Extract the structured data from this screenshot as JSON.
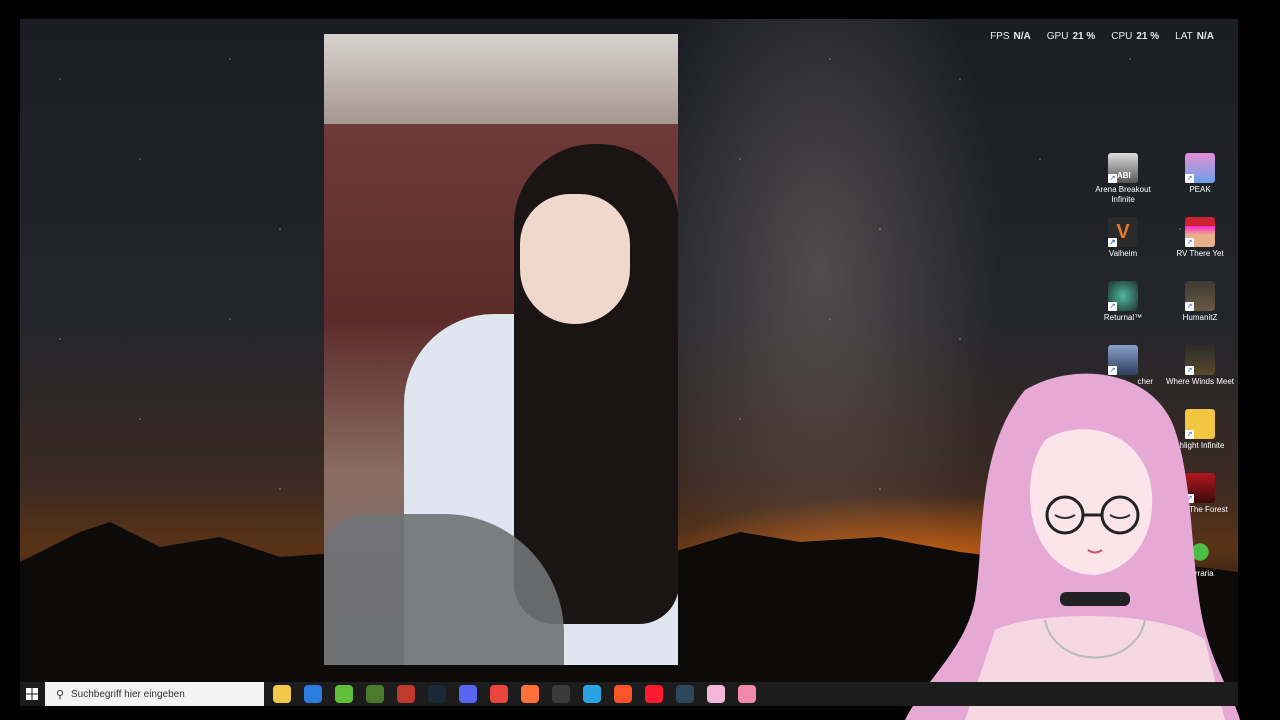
{
  "stats": [
    {
      "label": "FPS",
      "value": "N/A"
    },
    {
      "label": "GPU",
      "value": "21 %"
    },
    {
      "label": "CPU",
      "value": "21 %"
    },
    {
      "label": "LAT",
      "value": "N/A"
    }
  ],
  "desktop_icons": [
    {
      "label": "Arena Breakout Infinite",
      "icon": "arena-breakout-icon",
      "badge": "ABI"
    },
    {
      "label": "PEAK",
      "icon": "peak-icon"
    },
    {
      "label": "Valheim",
      "icon": "valheim-icon",
      "badge": "V"
    },
    {
      "label": "RV There Yet",
      "icon": "rv-there-yet-icon"
    },
    {
      "label": "Returnal™",
      "icon": "returnal-icon"
    },
    {
      "label": "HumanitZ",
      "icon": "humanitz-icon"
    },
    {
      "label": "cher",
      "icon": "launcher-icon"
    },
    {
      "label": "Where Winds Meet",
      "icon": "where-winds-meet-icon"
    },
    {
      "label": "chlight Infinite",
      "icon": "torchlight-infinite-icon"
    },
    {
      "label": "s Of The Forest",
      "icon": "sons-of-the-forest-icon"
    },
    {
      "label": "Terraria",
      "icon": "terraria-icon"
    }
  ],
  "taskbar": {
    "search_placeholder": "Suchbegriff hier eingeben",
    "apps": [
      {
        "name": "file-explorer-icon",
        "color": "#f2c94c"
      },
      {
        "name": "store-icon",
        "color": "#2d7de0"
      },
      {
        "name": "green-app-icon",
        "color": "#5fbf3b"
      },
      {
        "name": "minecraft-icon",
        "color": "#4a7b2c"
      },
      {
        "name": "red-app-icon",
        "color": "#c0392b"
      },
      {
        "name": "steam-icon",
        "color": "#1b2838"
      },
      {
        "name": "discord-icon",
        "color": "#5865f2"
      },
      {
        "name": "chrome-icon",
        "color": "#e8453c"
      },
      {
        "name": "firefox-icon",
        "color": "#ff7139"
      },
      {
        "name": "obs-icon",
        "color": "#3a3a3a"
      },
      {
        "name": "blue-app-icon",
        "color": "#2aa3e0"
      },
      {
        "name": "brave-icon",
        "color": "#fb542b"
      },
      {
        "name": "opera-icon",
        "color": "#ff1b2d"
      },
      {
        "name": "steam-app-icon",
        "color": "#2a475e"
      },
      {
        "name": "pink-app-icon",
        "color": "#f4b6d8"
      },
      {
        "name": "pink-bar-icon",
        "color": "#f08aa8"
      }
    ]
  }
}
